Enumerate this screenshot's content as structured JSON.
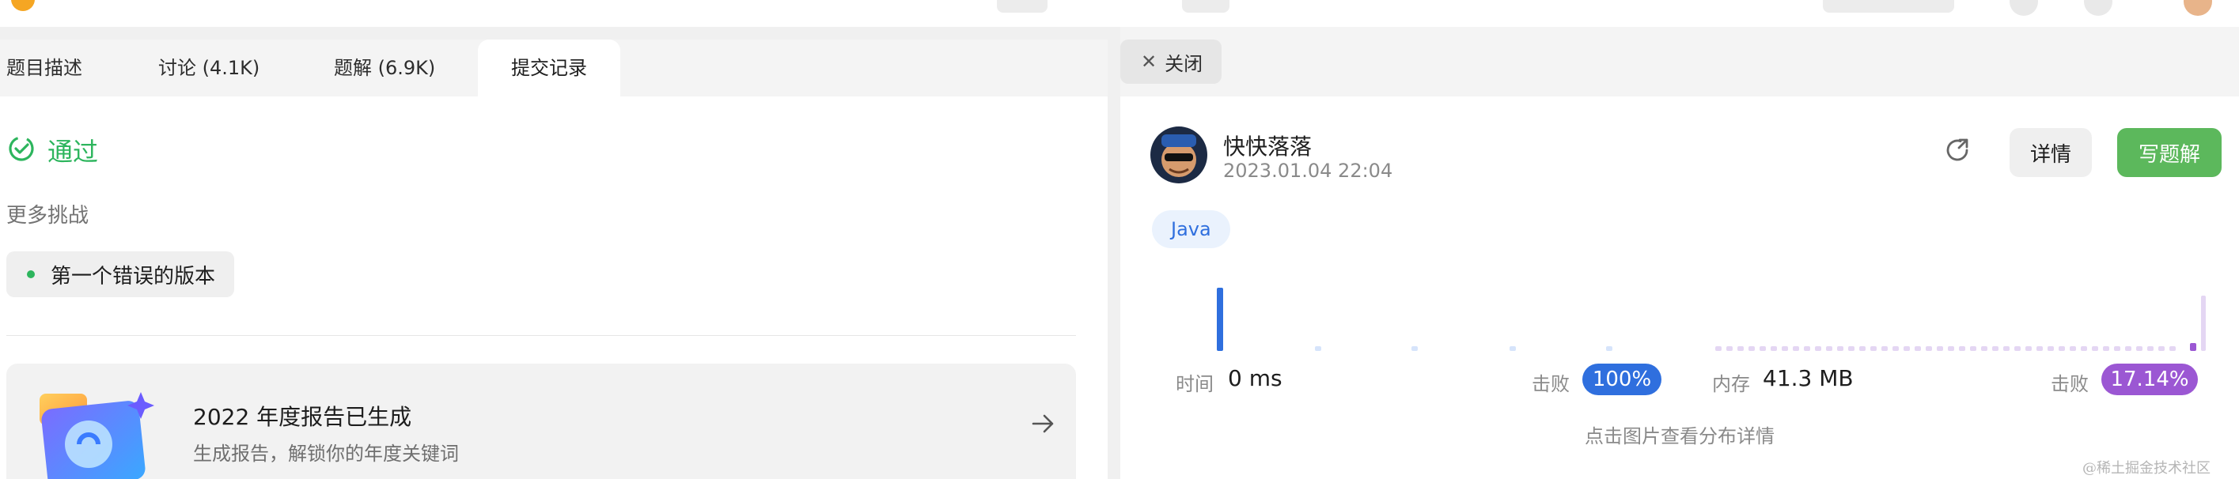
{
  "tabs": [
    "题目描述",
    "讨论 (4.1K)",
    "题解 (6.9K)",
    "提交记录"
  ],
  "status": {
    "label": "通过",
    "color": "#2db55d"
  },
  "more_challenges": {
    "title": "更多挑战",
    "items": [
      "第一个错误的版本"
    ]
  },
  "report": {
    "title": "2022 年度报告已生成",
    "subtitle": "生成报告，解锁你的年度关键词"
  },
  "close_label": "关闭",
  "submission": {
    "username": "快快落落",
    "datetime": "2023.01.04 22:04",
    "detail_label": "详情",
    "write_solution_label": "写题解",
    "language": "Java"
  },
  "runtime": {
    "label": "时间",
    "value": "0 ms",
    "beat_label": "击败",
    "beat_value": "100%",
    "distribution": [
      1.0,
      0.06,
      0.06,
      0.06,
      0.06
    ]
  },
  "memory": {
    "label": "内存",
    "value": "41.3 MB",
    "beat_label": "击败",
    "beat_value": "17.14%"
  },
  "hint": "点击图片查看分布详情",
  "watermark": "@稀土掘金技术社区",
  "colors": {
    "accent_green": "#2db55d",
    "write_button": "#5cb85c",
    "runtime_blue": "#2f6fde",
    "memory_purple": "#9b57d3"
  }
}
